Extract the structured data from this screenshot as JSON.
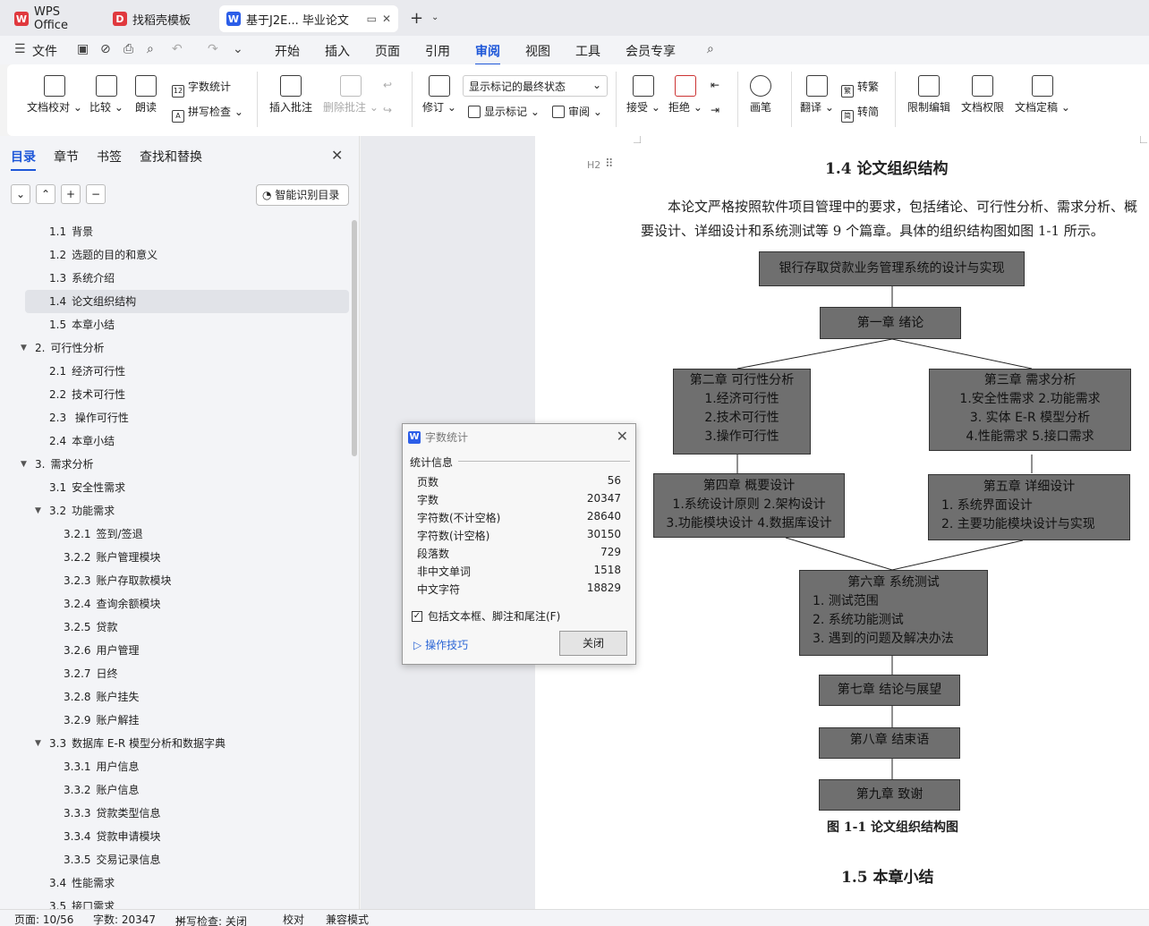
{
  "tabs": [
    {
      "label": "WPS Office",
      "icon": "wps-logo"
    },
    {
      "label": "找稻壳模板",
      "icon": "docer-logo"
    },
    {
      "label": "基于J2E... 毕业论文",
      "icon": "word-doc-icon"
    }
  ],
  "menu": {
    "file": "文件",
    "items": [
      "开始",
      "插入",
      "页面",
      "引用",
      "审阅",
      "视图",
      "工具",
      "会员专享"
    ],
    "active": "审阅"
  },
  "ribbon": {
    "doc_check": "文档校对",
    "compare": "比较",
    "read_aloud": "朗读",
    "word_count": "字数统计",
    "spell_check": "拼写检查",
    "insert_comment": "插入批注",
    "delete_comment": "删除批注",
    "revise": "修订",
    "markup_state": "显示标记的最终状态",
    "show_markup": "显示标记",
    "review": "审阅",
    "accept": "接受",
    "reject": "拒绝",
    "pen": "画笔",
    "translate": "翻译",
    "to_traditional": "转繁",
    "to_simplified": "转简",
    "restrict_edit": "限制编辑",
    "doc_permission": "文档权限",
    "doc_finalize": "文档定稿"
  },
  "panel": {
    "tabs": [
      "目录",
      "章节",
      "书签",
      "查找和替换"
    ],
    "smart_btn": "智能识别目录",
    "toc": [
      {
        "num": "1.1",
        "text": "背景",
        "level": 2
      },
      {
        "num": "1.2",
        "text": "选题的目的和意义",
        "level": 2
      },
      {
        "num": "1.3",
        "text": "系统介绍",
        "level": 2
      },
      {
        "num": "1.4",
        "text": "论文组织结构",
        "level": 2,
        "selected": true
      },
      {
        "num": "1.5",
        "text": "本章小结",
        "level": 2
      },
      {
        "num": "2.",
        "text": "可行性分析",
        "level": 1,
        "expanded": true
      },
      {
        "num": "2.1",
        "text": "经济可行性",
        "level": 2
      },
      {
        "num": "2.2",
        "text": "技术可行性",
        "level": 2
      },
      {
        "num": "2.3",
        "text": " 操作可行性",
        "level": 2
      },
      {
        "num": "2.4",
        "text": "本章小结",
        "level": 2
      },
      {
        "num": "3.",
        "text": "需求分析",
        "level": 1,
        "expanded": true
      },
      {
        "num": "3.1",
        "text": "安全性需求",
        "level": 2
      },
      {
        "num": "3.2",
        "text": "功能需求",
        "level": 2,
        "expanded": true
      },
      {
        "num": "3.2.1",
        "text": "签到/签退",
        "level": 3
      },
      {
        "num": "3.2.2",
        "text": "账户管理模块",
        "level": 3
      },
      {
        "num": "3.2.3",
        "text": "账户存取款模块",
        "level": 3
      },
      {
        "num": "3.2.4",
        "text": "查询余额模块",
        "level": 3
      },
      {
        "num": "3.2.5",
        "text": "贷款",
        "level": 3
      },
      {
        "num": "3.2.6",
        "text": "用户管理",
        "level": 3
      },
      {
        "num": "3.2.7",
        "text": "日终",
        "level": 3
      },
      {
        "num": "3.2.8",
        "text": "账户挂失",
        "level": 3
      },
      {
        "num": "3.2.9",
        "text": "账户解挂",
        "level": 3
      },
      {
        "num": "3.3",
        "text": "数据库 E-R 模型分析和数据字典",
        "level": 2,
        "expanded": true
      },
      {
        "num": "3.3.1",
        "text": "用户信息",
        "level": 3
      },
      {
        "num": "3.3.2",
        "text": "账户信息",
        "level": 3
      },
      {
        "num": "3.3.3",
        "text": "贷款类型信息",
        "level": 3
      },
      {
        "num": "3.3.4",
        "text": "贷款申请模块",
        "level": 3
      },
      {
        "num": "3.3.5",
        "text": "交易记录信息",
        "level": 3
      },
      {
        "num": "3.4",
        "text": "性能需求",
        "level": 2
      },
      {
        "num": "3.5",
        "text": "接口需求",
        "level": 2
      }
    ]
  },
  "document": {
    "heading_marker": "H2",
    "section_heading": "1.4  论文组织结构",
    "paragraph": "本论文严格按照软件项目管理中的要求，包括绪论、可行性分析、需求分析、概要设计、详细设计和系统测试等 9 个篇章。具体的组织结构图如图 1-1 所示。",
    "diagram": {
      "root": "银行存取贷款业务管理系统的设计与实现",
      "ch1": "第一章  绪论",
      "ch2": [
        "第二章  可行性分析",
        "1.经济可行性",
        "2.技术可行性",
        "3.操作可行性"
      ],
      "ch3": [
        "第三章  需求分析",
        "1.安全性需求  2.功能需求",
        "3. 实体 E-R 模型分析",
        "4.性能需求     5.接口需求"
      ],
      "ch4": [
        "第四章  概要设计",
        "1.系统设计原则  2.架构设计",
        "3.功能模块设计 4.数据库设计"
      ],
      "ch5": [
        "第五章  详细设计",
        "1.  系统界面设计",
        "2.  主要功能模块设计与实现"
      ],
      "ch6": [
        "第六章  系统测试",
        "1.  测试范围",
        "2.  系统功能测试",
        "3.  遇到的问题及解决办法"
      ],
      "ch7": "第七章  结论与展望",
      "ch8": "第八章  结束语",
      "ch9": "第九章  致谢"
    },
    "figure_caption": "图 1-1  论文组织结构图",
    "next_heading": "1.5  本章小结"
  },
  "dialog": {
    "title": "字数统计",
    "section": "统计信息",
    "stats": [
      {
        "label": "页数",
        "value": "56"
      },
      {
        "label": "字数",
        "value": "20347"
      },
      {
        "label": "字符数(不计空格)",
        "value": "28640"
      },
      {
        "label": "字符数(计空格)",
        "value": "30150"
      },
      {
        "label": "段落数",
        "value": "729"
      },
      {
        "label": "非中文单词",
        "value": "1518"
      },
      {
        "label": "中文字符",
        "value": "18829"
      }
    ],
    "checkbox_label": "包括文本框、脚注和尾注(F)",
    "checkbox_checked": true,
    "tips": "操作技巧",
    "close_btn": "关闭"
  },
  "status": {
    "page": "页面: 10/56",
    "words": "字数: 20347",
    "spell": "拼写检查: 关闭",
    "proof": "校对",
    "compat": "兼容模式"
  },
  "colors": {
    "accent": "#1e57d8",
    "wps_red": "#e0393e",
    "word_blue": "#2c5ee8",
    "diagram_box": "#6f6f6f"
  }
}
